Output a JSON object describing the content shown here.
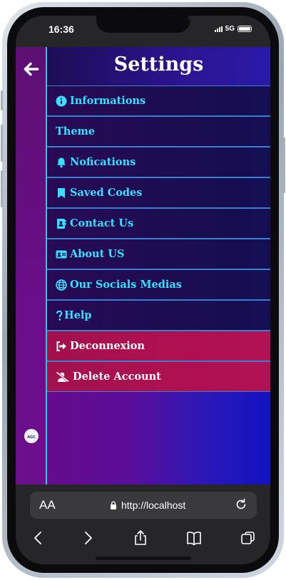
{
  "status_bar": {
    "time": "16:36",
    "network": "5G"
  },
  "page": {
    "title": "Settings"
  },
  "menu": [
    {
      "label": "Informations",
      "icon": "info-icon"
    },
    {
      "label": "Theme",
      "icon": ""
    },
    {
      "label": "Nofications",
      "icon": "bell-icon"
    },
    {
      "label": "Saved Codes",
      "icon": "bookmark-icon"
    },
    {
      "label": "Contact Us",
      "icon": "contact-book-icon"
    },
    {
      "label": "About US",
      "icon": "id-card-icon"
    },
    {
      "label": "Our Socials Medias",
      "icon": "globe-icon"
    },
    {
      "label": "Help",
      "icon": "question-icon"
    },
    {
      "label": "Deconnexion",
      "icon": "logout-icon",
      "danger": true
    },
    {
      "label": "Delete Account",
      "icon": "user-slash-icon",
      "danger": true
    }
  ],
  "sidebar": {
    "logo_text": "AGC"
  },
  "browser": {
    "text_size_label": "AA",
    "url": "http://localhost"
  },
  "colors": {
    "accent_text": "#37e0ff",
    "danger_bg": "#b01050",
    "divider": "#3b7fd0"
  }
}
